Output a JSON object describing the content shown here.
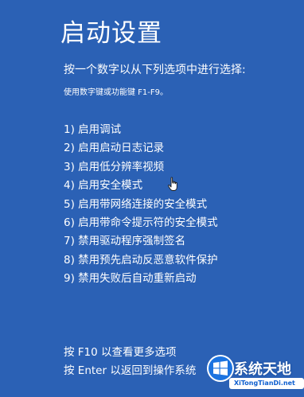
{
  "screen": {
    "title": "启动设置",
    "prompt": "按一个数字以从下列选项中进行选择:",
    "hint": "使用数字键或功能键 F1-F9。",
    "background_color": "#2b61b5",
    "text_color": "#ffffff"
  },
  "options": [
    {
      "label": "1) 启用调试"
    },
    {
      "label": "2) 启用启动日志记录"
    },
    {
      "label": "3) 启用低分辨率视频"
    },
    {
      "label": "4) 启用安全模式"
    },
    {
      "label": "5) 启用带网络连接的安全模式"
    },
    {
      "label": "6) 启用带命令提示符的安全模式"
    },
    {
      "label": "7) 禁用驱动程序强制签名"
    },
    {
      "label": "8) 禁用预先启动反恶意软件保护"
    },
    {
      "label": "9) 禁用失败后自动重新启动"
    }
  ],
  "footer": {
    "more_options": "按 F10 以查看更多选项",
    "back_to_os": "按 Enter 以返回到操作系统"
  },
  "cursor": {
    "icon": "hand-pointer-icon"
  },
  "watermark": {
    "name": "系统天地",
    "url": "XiTongTianDi.net",
    "icon": "windows-logo-icon",
    "accent_color": "#0e5fcf"
  }
}
